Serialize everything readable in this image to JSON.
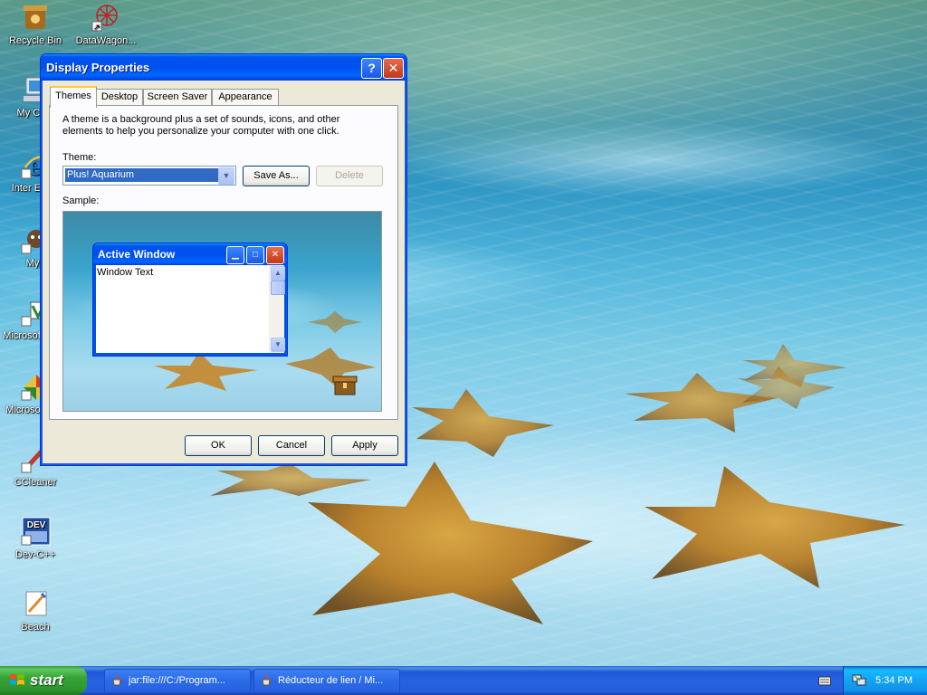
{
  "desktop": {
    "icons": [
      {
        "label": "Recycle Bin",
        "icon": "recycle-bin-icon"
      },
      {
        "label": "DataWagon...",
        "icon": "datawagon-icon"
      },
      {
        "label": "My Com",
        "icon": "my-computer-icon"
      },
      {
        "label": "Inter Explo",
        "icon": "internet-explorer-icon"
      },
      {
        "label": "Myp",
        "icon": "mypaint-icon"
      },
      {
        "label": "Microsof Basic",
        "icon": "visual-basic-icon"
      },
      {
        "label": "Microsof C++",
        "icon": "visual-cpp-icon"
      },
      {
        "label": "CCleaner",
        "icon": "ccleaner-icon"
      },
      {
        "label": "Dev-C++",
        "icon": "dev-cpp-icon"
      },
      {
        "label": "Beach",
        "icon": "beach-icon"
      }
    ],
    "dev_icon_text": "DEV"
  },
  "window": {
    "title": "Display Properties",
    "help_glyph": "?",
    "close_glyph": "✕",
    "tabs": [
      "Themes",
      "Desktop",
      "Screen Saver",
      "Appearance"
    ],
    "description": "A theme is a background plus a set of sounds, icons, and other elements to help you personalize your computer with one click.",
    "theme_label": "Theme:",
    "theme_value": "Plus! Aquarium",
    "save_as": "Save As...",
    "delete": "Delete",
    "sample_label": "Sample:",
    "sample": {
      "window_title": "Active Window",
      "window_text": "Window Text"
    },
    "ok": "OK",
    "cancel": "Cancel",
    "apply": "Apply"
  },
  "taskbar": {
    "start_label": "start",
    "tasks": [
      {
        "label": "jar:file:///C:/Program...",
        "icon": "java-cup-icon"
      },
      {
        "label": "Réducteur de lien / Mi...",
        "icon": "java-cup-icon"
      }
    ],
    "clock": "5:34 PM"
  },
  "colors": {
    "titlebar_blue": "#0054e3",
    "start_green": "#37a337",
    "selection_blue": "#316ac5",
    "tab_highlight": "#ffc83c"
  }
}
